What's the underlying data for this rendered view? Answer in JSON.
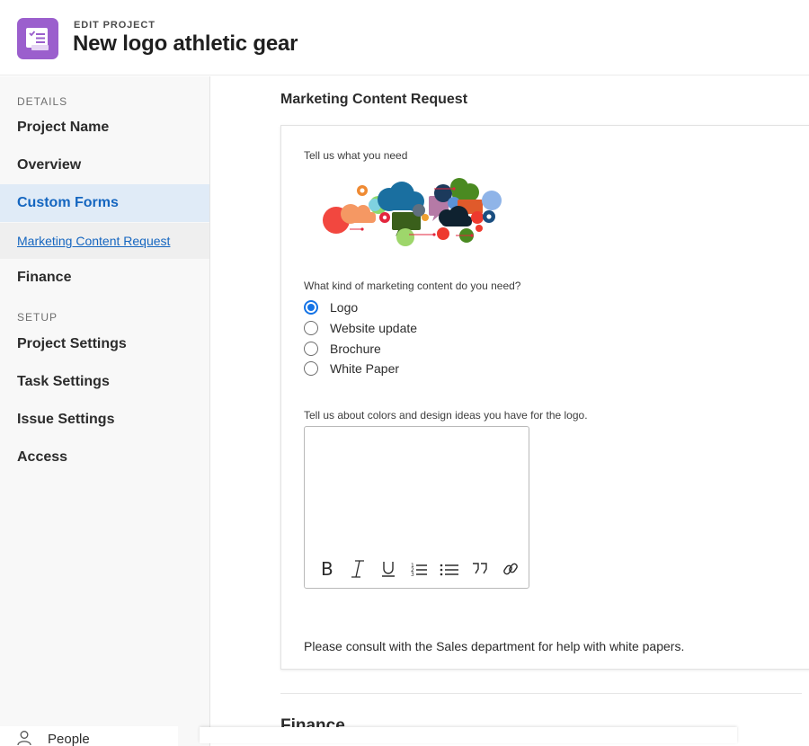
{
  "header": {
    "eyebrow": "EDIT PROJECT",
    "title": "New logo athletic gear",
    "icon": "project-form-icon",
    "icon_color": "#9b5fcd"
  },
  "sidebar": {
    "details_label": "DETAILS",
    "setup_label": "SETUP",
    "items": [
      {
        "label": "Project Name"
      },
      {
        "label": "Overview"
      },
      {
        "label": "Custom Forms",
        "active": true
      },
      {
        "label": "Marketing Content Request",
        "sub": true
      },
      {
        "label": "Finance"
      },
      {
        "label": "Project Settings"
      },
      {
        "label": "Task Settings"
      },
      {
        "label": "Issue Settings"
      },
      {
        "label": "Access"
      }
    ],
    "footer": {
      "label": "People",
      "icon": "person-icon"
    }
  },
  "main": {
    "section_title": "Marketing Content Request",
    "form": {
      "need_label": "Tell us what you need",
      "image": "marketing-collage-image",
      "question": "What kind of marketing content do you need?",
      "options": [
        {
          "label": "Logo",
          "checked": true
        },
        {
          "label": "Website update",
          "checked": false
        },
        {
          "label": "Brochure",
          "checked": false
        },
        {
          "label": "White Paper",
          "checked": false
        }
      ],
      "textarea_label": "Tell us about colors and design ideas you have for the logo.",
      "textarea_value": "",
      "toolbar": [
        "bold-icon",
        "italic-icon",
        "underline-icon",
        "numbered-list-icon",
        "bulleted-list-icon",
        "quote-icon",
        "link-icon"
      ],
      "note": "Please consult with the Sales department for help with white papers."
    },
    "next_section_title": "Finance"
  },
  "colors": {
    "accent": "#1473e6",
    "link": "#1566c0",
    "active_bg": "#e0ebf7"
  }
}
